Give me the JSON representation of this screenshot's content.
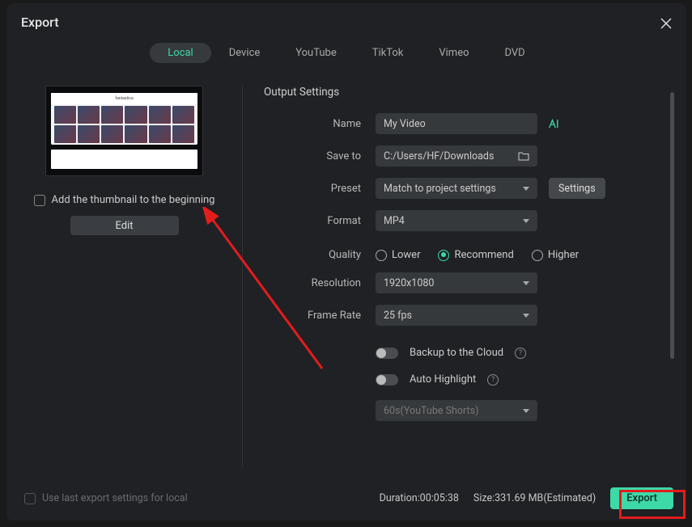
{
  "dialog": {
    "title": "Export"
  },
  "tabs": [
    {
      "label": "Local",
      "active": true
    },
    {
      "label": "Device",
      "active": false
    },
    {
      "label": "YouTube",
      "active": false
    },
    {
      "label": "TikTok",
      "active": false
    },
    {
      "label": "Vimeo",
      "active": false
    },
    {
      "label": "DVD",
      "active": false
    }
  ],
  "left": {
    "addThumbnail": "Add the thumbnail to the beginning",
    "editButton": "Edit"
  },
  "settings": {
    "sectionTitle": "Output Settings",
    "nameLabel": "Name",
    "nameValue": "My Video",
    "saveToLabel": "Save to",
    "saveToValue": "C:/Users/HF/Downloads",
    "presetLabel": "Preset",
    "presetValue": "Match to project settings",
    "settingsButton": "Settings",
    "formatLabel": "Format",
    "formatValue": "MP4",
    "qualityLabel": "Quality",
    "qualityOptions": {
      "lower": "Lower",
      "recommend": "Recommend",
      "higher": "Higher"
    },
    "qualitySelected": "recommend",
    "resolutionLabel": "Resolution",
    "resolutionValue": "1920x1080",
    "frameRateLabel": "Frame Rate",
    "frameRateValue": "25 fps",
    "backup": "Backup to the Cloud",
    "autoHighlight": "Auto Highlight",
    "highlightPreset": "60s(YouTube Shorts)"
  },
  "footer": {
    "useLast": "Use last export settings for local",
    "duration": "Duration:00:05:38",
    "size": "Size:331.69 MB(Estimated)",
    "export": "Export"
  }
}
